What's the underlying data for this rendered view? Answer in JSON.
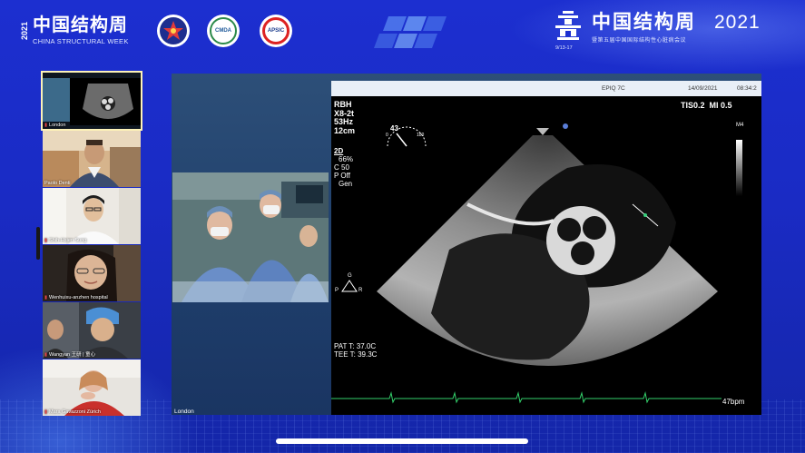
{
  "header": {
    "left_logo": {
      "year": "2021",
      "title_cn": "中国结构周",
      "title_en": "CHINA STRUCTURAL WEEK"
    },
    "badges": [
      {
        "name": "society-emblem",
        "text": ""
      },
      {
        "name": "cmda-emblem",
        "text": "CMDA"
      },
      {
        "name": "apsic-emblem",
        "text": "APSIC"
      }
    ],
    "right_logo": {
      "title_cn": "中国结构周",
      "year": "2021",
      "subtitle": "暨第五届中国国际结构性心脏病会议",
      "dates": "9/13-17"
    }
  },
  "participants": [
    {
      "label": "London",
      "kind": "screen",
      "active": true,
      "mic_muted": true
    },
    {
      "label": "Paolo Denti",
      "kind": "person",
      "active": false,
      "mic_muted": false
    },
    {
      "label": "Shih-Hsien Sung",
      "kind": "person",
      "active": false,
      "mic_muted": true
    },
    {
      "label": "Wenhuixu-anzhen hospital",
      "kind": "person",
      "active": false,
      "mic_muted": true
    },
    {
      "label": "Wangyan 王研 | 童心",
      "kind": "person",
      "active": false,
      "mic_muted": true
    },
    {
      "label": "Mara Gavazzoni Zürich",
      "kind": "person",
      "active": false,
      "mic_muted": true
    }
  ],
  "stage": {
    "label": "London",
    "echo": {
      "device": "EPIQ 7C",
      "date": "14/09/2021",
      "time": "08:34:2",
      "hospital": "RBH",
      "probe": "X8-2t",
      "frame_rate": "53Hz",
      "depth": "12cm",
      "mode": "2D",
      "gain": "66%",
      "compression": "C 50",
      "persistence": "P Off",
      "general": "Gen",
      "tis": "TIS0.2",
      "mi": "MI 0.5",
      "map": "M4",
      "angle": "43",
      "angle_min": "0",
      "angle_max": "180",
      "pat_temp": "PAT T: 37.0C",
      "tee_temp": "TEE T: 39.3C",
      "heart_rate": "47bpm"
    }
  },
  "colors": {
    "background": "#1c2fd0",
    "active_outline": "#fdf2b8",
    "muted_mic": "#e04848",
    "ecg_trace": "#33d16b"
  }
}
